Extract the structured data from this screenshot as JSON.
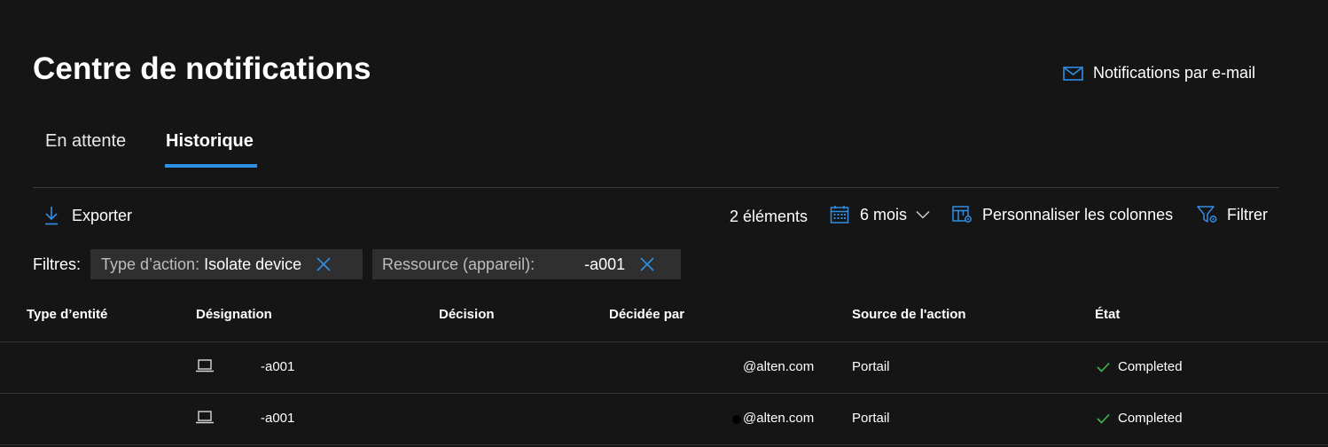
{
  "header": {
    "title": "Centre de notifications",
    "email_link": "Notifications par e-mail"
  },
  "tabs": [
    {
      "label": "En attente",
      "active": false
    },
    {
      "label": "Historique",
      "active": true
    }
  ],
  "toolbar": {
    "export_label": "Exporter",
    "item_count": "2 éléments",
    "period_label": "6 mois",
    "customize_columns_label": "Personnaliser les colonnes",
    "filter_label": "Filtrer"
  },
  "filters": {
    "label": "Filtres:",
    "chips": [
      {
        "key": "Type d’action:",
        "value": "Isolate device"
      },
      {
        "key": "Ressource (appareil):",
        "value": "-a001"
      }
    ]
  },
  "table": {
    "columns": [
      "Type d’entité",
      "Désignation",
      "Décision",
      "Décidée par",
      "Source de l'action",
      "État"
    ],
    "rows": [
      {
        "entity_type": "",
        "designation": "-a001",
        "decision": "",
        "decided_by": "@alten.com",
        "source": "Portail",
        "status": "Completed"
      },
      {
        "entity_type": "",
        "designation": "-a001",
        "decision": "",
        "decided_by": "@alten.com",
        "source": "Portail",
        "status": "Completed"
      }
    ]
  },
  "colors": {
    "background": "#151515",
    "accent": "#2f8fe6",
    "success": "#3fb950",
    "chip_background": "#2f2f2f"
  },
  "icons": {
    "email": "mail-icon",
    "export": "download-icon",
    "period": "calendar-icon",
    "dropdown": "chevron-down-icon",
    "customize": "columns-settings-icon",
    "filter": "filter-icon",
    "chip_remove": "close-icon",
    "device": "laptop-icon",
    "status": "checkmark-icon"
  }
}
